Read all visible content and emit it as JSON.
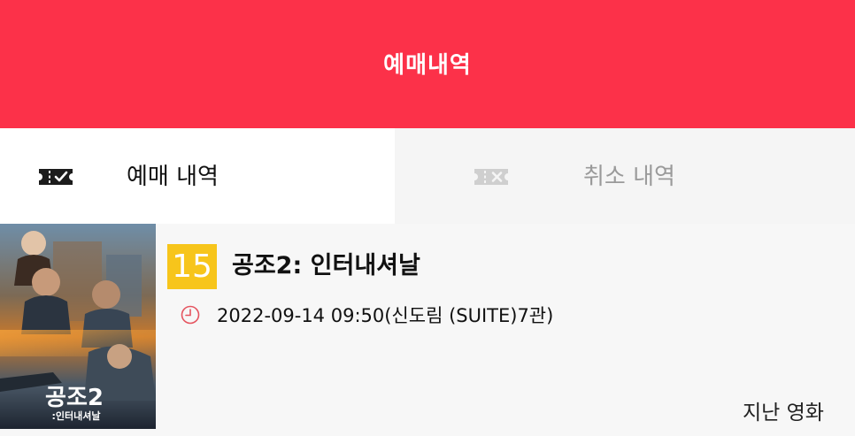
{
  "header": {
    "title": "예매내역"
  },
  "tabs": [
    {
      "label": "예매 내역",
      "icon": "ticket-check-icon",
      "active": true
    },
    {
      "label": "취소 내역",
      "icon": "ticket-cancel-icon",
      "active": false
    }
  ],
  "booking": {
    "rating": "15",
    "rating_color": "#f7c51b",
    "movie_title": "공조2: 인터내셔날",
    "showtime": "2022-09-14 09:50(신도림 (SUITE)7관)",
    "poster_title": "공조2",
    "poster_subtitle": ":인터내셔날",
    "status": "지난 영화"
  },
  "colors": {
    "accent": "#fc3149",
    "active_tab_bg": "#ffffff",
    "inactive_tab_bg": "#f5f5f5"
  }
}
